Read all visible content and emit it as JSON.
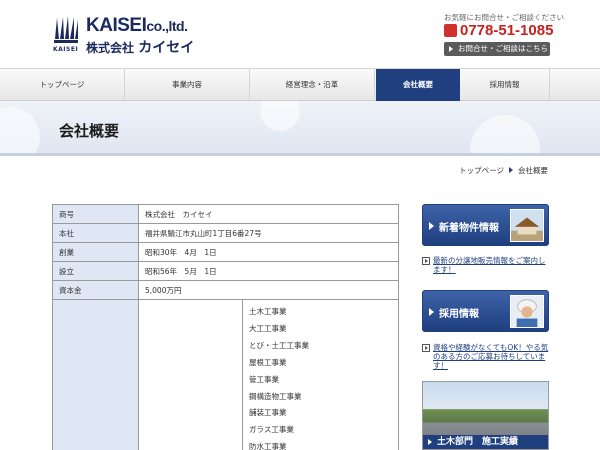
{
  "header": {
    "logo_en": "KAISEI",
    "logo_en_suffix": "co.,ltd.",
    "logo_jp_prefix": "株式会社",
    "logo_jp_name": "カイセイ",
    "logo_caption": "KAISEI",
    "contact_note": "お気軽にお問合せ・ご相談ください",
    "phone": "0778-51-1085",
    "contact_button": "お問合せ・ご相談はこちら"
  },
  "nav": {
    "items": [
      {
        "label": "トップページ"
      },
      {
        "label": "事業内容"
      },
      {
        "label": "経営理念・沿革"
      },
      {
        "label": "会社概要"
      },
      {
        "label": "採用情報"
      }
    ]
  },
  "page": {
    "title": "会社概要"
  },
  "breadcrumb": {
    "home": "トップページ",
    "current": "会社概要"
  },
  "company": {
    "rows": [
      {
        "label": "商号",
        "value": "株式会社　カイセイ"
      },
      {
        "label": "本社",
        "value": "福井県鯖江市丸山町1丁目6番27号"
      },
      {
        "label": "創業",
        "value": "昭和30年　4月　1日"
      },
      {
        "label": "設立",
        "value": "昭和56年　5月　1日"
      },
      {
        "label": "資本金",
        "value": "5,000万円"
      }
    ],
    "businesses": [
      "土木工事業",
      "大工工事業",
      "とび・土工工事業",
      "屋根工事業",
      "管工事業",
      "鋼構造物工事業",
      "舗装工事業",
      "ガラス工事業",
      "防水工事業"
    ]
  },
  "sidebar": {
    "new_listing_banner": "新着物件情報",
    "new_listing_text": "最新の分譲地販売情報をご案内します！",
    "recruit_banner": "採用情報",
    "recruit_text": "資格や経験がなくてもOK！やる気のある方のご応募お待ちしています！",
    "civil_banner": "土木部門　施工実績"
  },
  "colors": {
    "brand_navy": "#1f3f7f",
    "phone_red": "#c8211e",
    "table_header": "#dfe7f4"
  }
}
